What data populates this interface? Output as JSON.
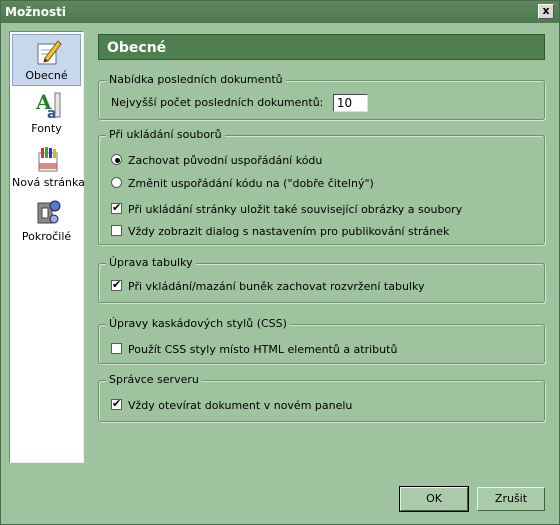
{
  "window": {
    "title": "Možnosti",
    "close_label": "x"
  },
  "sidebar": {
    "items": [
      {
        "label": "Obecné",
        "icon": "pencil-paper-icon",
        "selected": true
      },
      {
        "label": "Fonty",
        "icon": "font-icon",
        "selected": false
      },
      {
        "label": "Nová stránka",
        "icon": "new-page-icon",
        "selected": false
      },
      {
        "label": "Pokročilé",
        "icon": "advanced-icon",
        "selected": false
      }
    ]
  },
  "main": {
    "heading": "Obecné",
    "groups": {
      "recent": {
        "title": "Nabídka posledních dokumentů",
        "max_label": "Nejvyšší počet posledních dokumentů:",
        "max_value": "10"
      },
      "saving": {
        "title": "Při ukládání souborů",
        "radio_keep": "Zachovat původní uspořádání kódu",
        "radio_change": "Změnit uspořádání kódu na (\"dobře čitelný\")",
        "check_save_related": "Při ukládání stránky uložit také související obrázky a soubory",
        "check_show_dialog": "Vždy zobrazit dialog s nastavením pro publikování stránek",
        "radio_keep_checked": true,
        "check_save_related_checked": true,
        "check_show_dialog_checked": false
      },
      "table": {
        "title": "Úprava tabulky",
        "check_keep_layout": "Při vkládání/mazání buněk zachovat rozvržení tabulky",
        "checked": true
      },
      "css": {
        "title": "Úpravy kaskádových stylů (CSS)",
        "check_use_css": "Použít CSS styly místo HTML elementů a atributů",
        "checked": false
      },
      "server": {
        "title": "Správce serveru",
        "check_new_panel": "Vždy otevírat dokument v novém panelu",
        "checked": true
      }
    }
  },
  "buttons": {
    "ok": "OK",
    "cancel": "Zrušit"
  },
  "colors": {
    "accent": "#4f7f4f",
    "background": "#9fc39f",
    "selection": "#c8d8ec"
  }
}
